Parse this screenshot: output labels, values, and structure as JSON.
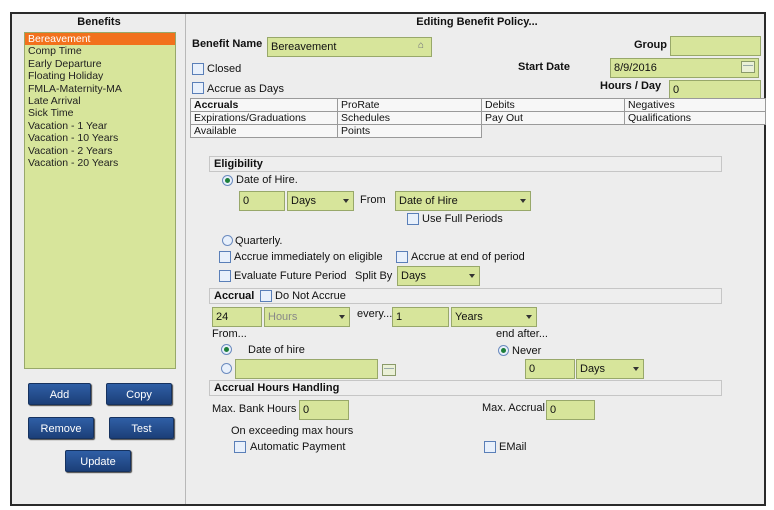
{
  "left": {
    "title": "Benefits",
    "items": [
      "Bereavement",
      "Comp Time",
      "Early Departure",
      "Floating Holiday",
      "FMLA-Maternity-MA",
      "Late Arrival",
      "Sick Time",
      "Vacation - 1 Year",
      "Vacation - 10 Years",
      "Vacation - 2 Years",
      "Vacation - 20 Years"
    ],
    "buttons": {
      "add": "Add",
      "copy": "Copy",
      "remove": "Remove",
      "test": "Test",
      "update": "Update"
    }
  },
  "header": {
    "title": "Editing Benefit Policy...",
    "benefit_name_label": "Benefit Name",
    "benefit_name_value": "Bereavement",
    "group_label": "Group",
    "group_value": "",
    "closed_label": "Closed",
    "accrue_days_label": "Accrue as Days",
    "start_date_label": "Start Date",
    "start_date_value": "8/9/2016",
    "hours_day_label": "Hours / Day",
    "hours_day_value": "0"
  },
  "tabs": {
    "row1": [
      "Accruals",
      "ProRate",
      "Debits",
      "Negatives"
    ],
    "row2": [
      "Expirations/Graduations",
      "Schedules",
      "Pay Out",
      "Qualifications"
    ],
    "row3": [
      "Available",
      "Points"
    ]
  },
  "eligibility": {
    "title": "Eligibility",
    "date_of_hire": "Date of Hire.",
    "offset_value": "0",
    "offset_unit": "Days",
    "from_label": "From",
    "from_value": "Date of Hire",
    "use_full_periods": "Use Full Periods",
    "quarterly": "Quarterly.",
    "accrue_immediately": "Accrue immediately on eligible",
    "accrue_end": "Accrue at end of period",
    "evaluate_future": "Evaluate Future Period",
    "split_by_label": "Split By",
    "split_by_value": "Days"
  },
  "accrual": {
    "title": "Accrual",
    "do_not_accrue": "Do Not Accrue",
    "amount_value": "24",
    "amount_unit": "Hours",
    "every_label": "every...",
    "every_value": "1",
    "every_unit": "Years",
    "from_label": "From...",
    "date_of_hire": "Date of hire",
    "end_after_label": "end after...",
    "never": "Never",
    "end_value": "0",
    "end_unit": "Days"
  },
  "handling": {
    "title": "Accrual Hours Handling",
    "max_bank_label": "Max. Bank Hours",
    "max_bank_value": "0",
    "max_accrual_label": "Max. Accrual",
    "max_accrual_value": "0",
    "on_exceeding": "On exceeding max hours",
    "automatic_payment": "Automatic Payment",
    "email": "EMail"
  }
}
